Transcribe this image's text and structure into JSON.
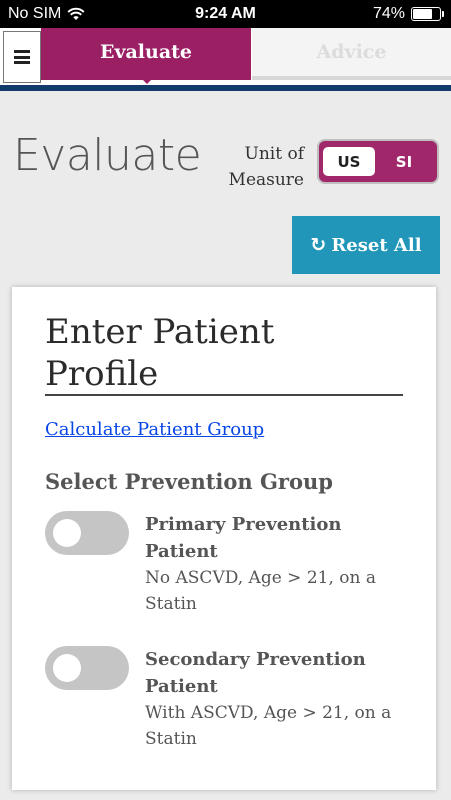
{
  "status_bar": {
    "carrier": "No SIM",
    "time": "9:24 AM",
    "battery_percent": "74%",
    "battery_level": 0.74
  },
  "nav": {
    "menu_icon": "hamburger-icon",
    "tabs": [
      {
        "label": "Evaluate",
        "active": true
      },
      {
        "label": "Advice",
        "active": false
      }
    ],
    "accent_color": "#9a1f63",
    "rule_color": "#123a6b"
  },
  "header": {
    "title": "Evaluate",
    "unit_label_line1": "Unit of",
    "unit_label_line2": "Measure",
    "unit_options": [
      "US",
      "SI"
    ],
    "unit_selected": "US",
    "reset_icon": "refresh-icon",
    "reset_label": "Reset All",
    "reset_color": "#2196b8"
  },
  "profile": {
    "title_line1": "Enter Patient",
    "title_line2": "Profile",
    "calc_link": "Calculate Patient Group",
    "section_heading": "Select Prevention Group",
    "options": [
      {
        "title_line1": "Primary Prevention",
        "title_line2": "Patient",
        "desc_line1": "No ASCVD, Age > 21, on a",
        "desc_line2": "Statin",
        "checked": false
      },
      {
        "title_line1": "Secondary Prevention",
        "title_line2": "Patient",
        "desc_line1": "With ASCVD, Age > 21, on a",
        "desc_line2": "Statin",
        "checked": false
      }
    ]
  }
}
